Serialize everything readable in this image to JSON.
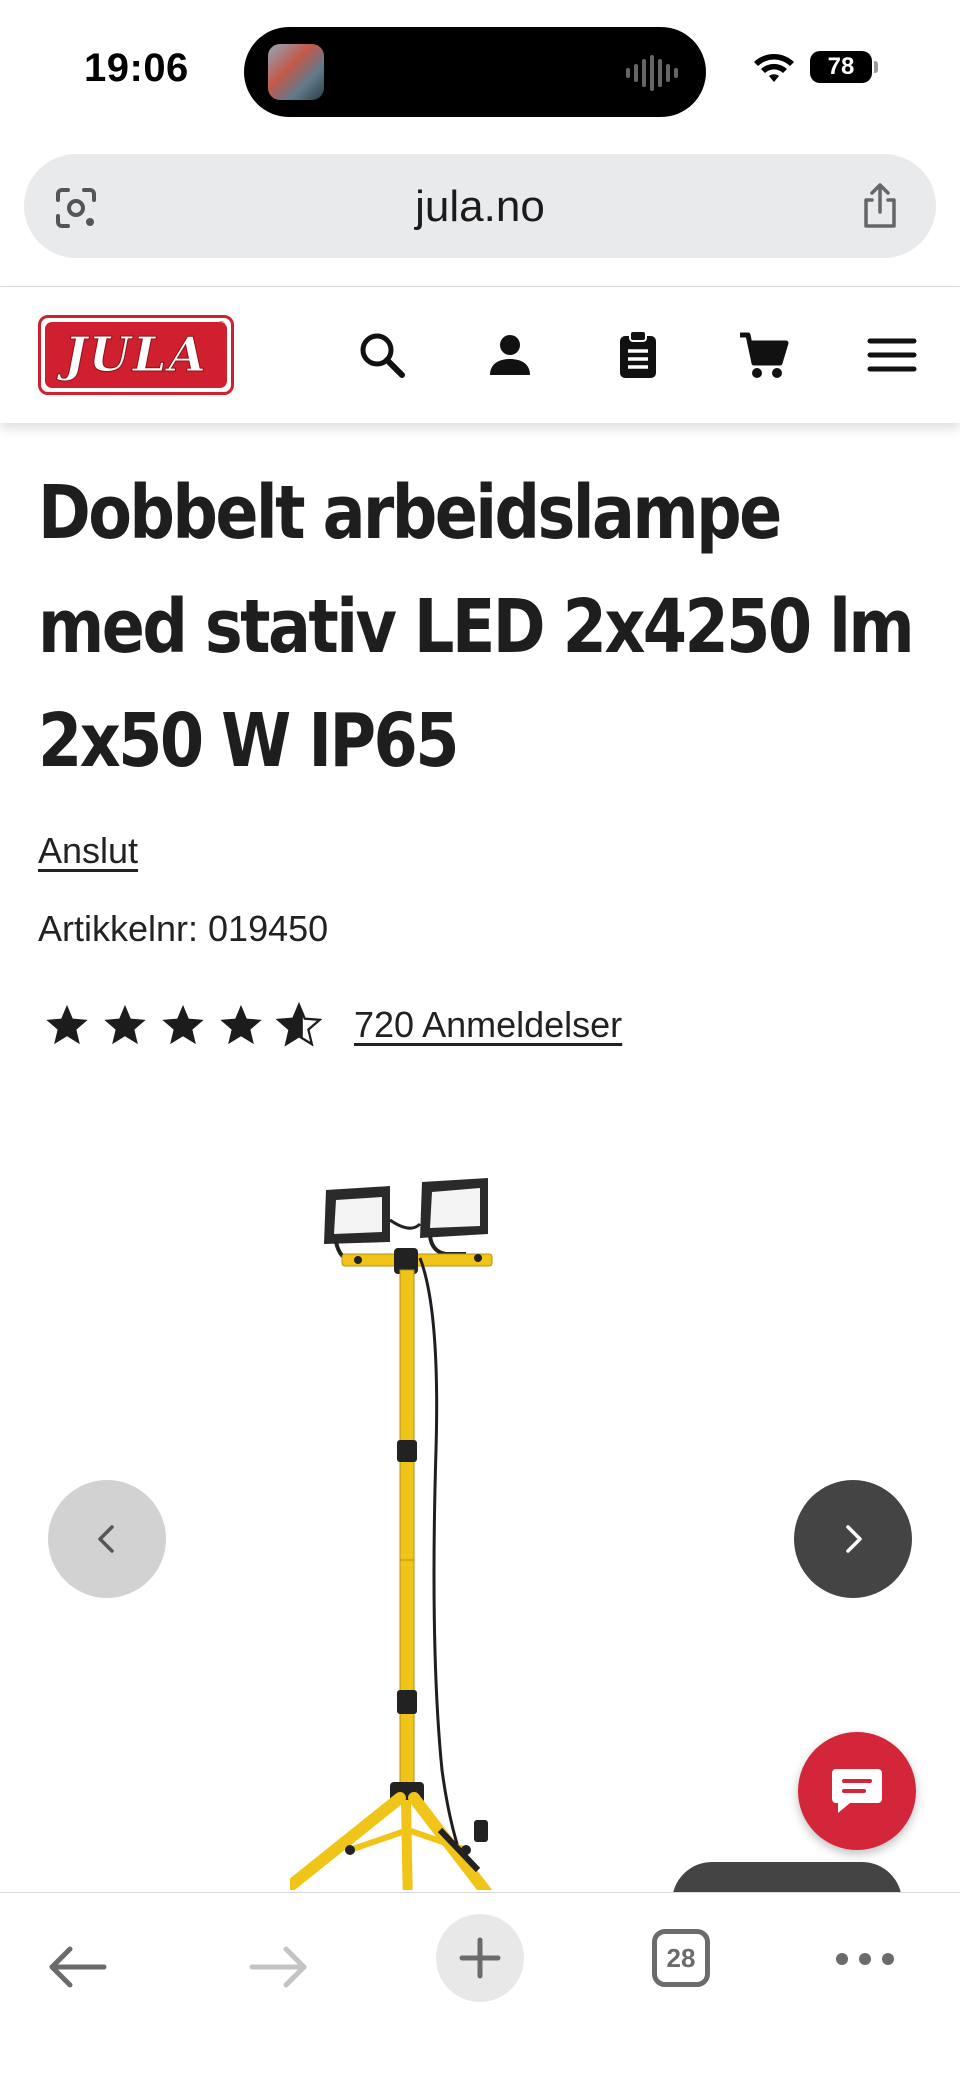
{
  "status_bar": {
    "time": "19:06",
    "battery": "78"
  },
  "browser": {
    "url": "jula.no",
    "tab_count": "28"
  },
  "site": {
    "logo_text": "JULA",
    "logo_reg": "®",
    "brand_color": "#d0202f"
  },
  "product": {
    "title_lines": [
      "Dobbelt arbeidslampe",
      "med stativ LED 2x4250 lm",
      "2x50 W IP65"
    ],
    "brand": "Anslut",
    "article_number": "Artikkelnr: 019450",
    "rating": 4.5,
    "reviews_text": "720 Anmeldelser"
  },
  "colors": {
    "chat_button": "#d3263a",
    "next_button": "#444444",
    "prev_button": "#d2d2d2",
    "lamp_yellow": "#f0c419"
  },
  "icons": {
    "header": [
      "search-icon",
      "user-icon",
      "clipboard-icon",
      "cart-icon",
      "menu-icon"
    ],
    "toolbar": [
      "back-arrow-icon",
      "forward-arrow-icon",
      "plus-icon",
      "tabs-icon",
      "more-icon"
    ]
  }
}
